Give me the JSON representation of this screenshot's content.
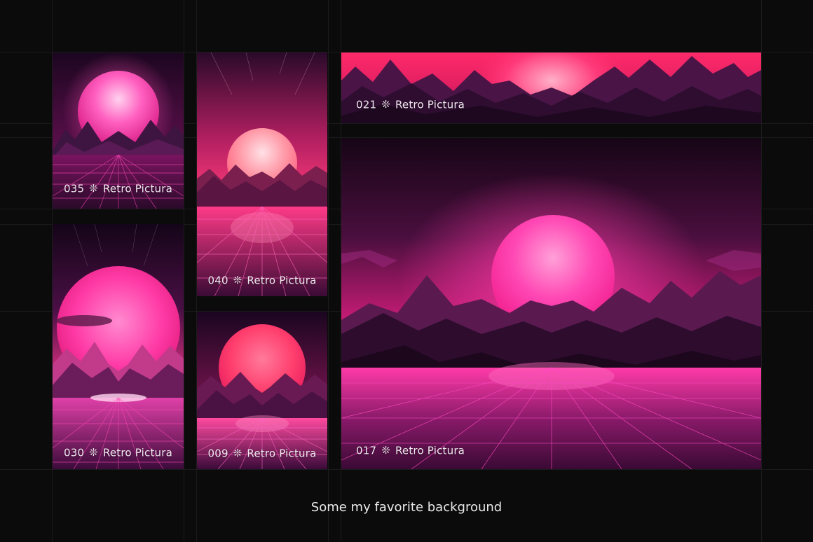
{
  "tiles": {
    "t035": {
      "number": "035",
      "name": "Retro Pictura"
    },
    "t030": {
      "number": "030",
      "name": "Retro Pictura"
    },
    "t040": {
      "number": "040",
      "name": "Retro Pictura"
    },
    "t009": {
      "number": "009",
      "name": "Retro Pictura"
    },
    "t021": {
      "number": "021",
      "name": "Retro Pictura"
    },
    "t017": {
      "number": "017",
      "name": "Retro Pictura"
    }
  },
  "separator_glyph": "❊",
  "caption": "Some my favorite background",
  "colors": {
    "background": "#0b0b0b",
    "sky_top": "#2a0a2e",
    "sky_glow": "#ff2f8a",
    "sun": "#ff3fa5",
    "mountain": "#3a1538",
    "grid": "#ff3fb0"
  }
}
